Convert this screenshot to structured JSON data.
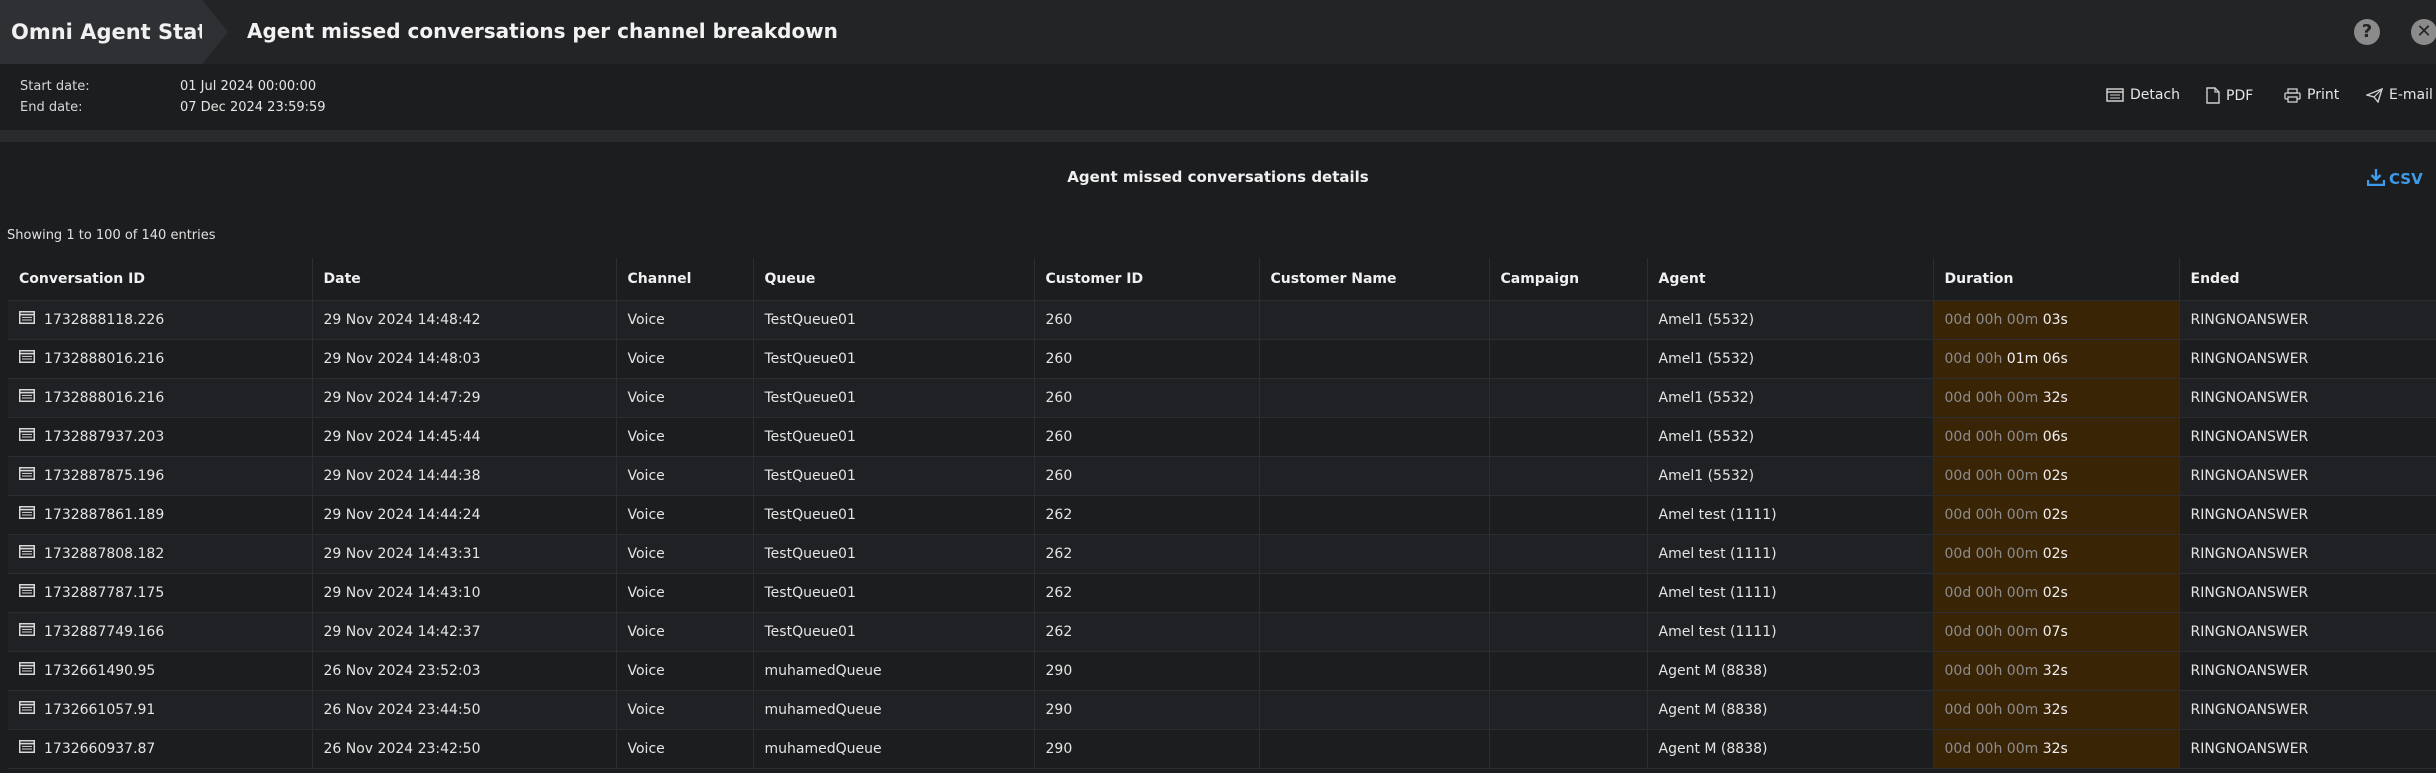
{
  "header": {
    "breadcrumb_root": "Omni Agent Stati...",
    "title": "Agent missed conversations per channel breakdown"
  },
  "dates": {
    "start_label": "Start date:",
    "start_value": "01 Jul 2024 00:00:00",
    "end_label": "End date:",
    "end_value": "07 Dec 2024 23:59:59"
  },
  "toolbar": {
    "detach": "Detach",
    "pdf": "PDF",
    "print": "Print",
    "email": "E-mail"
  },
  "section": {
    "title": "Agent missed conversations details",
    "csv": "CSV",
    "showing": "Showing 1 to 100 of 140 entries"
  },
  "table": {
    "columns": [
      "Conversation ID",
      "Date",
      "Channel",
      "Queue",
      "Customer ID",
      "Customer Name",
      "Campaign",
      "Agent",
      "Duration",
      "Ended"
    ],
    "rows": [
      {
        "id": "1732888118.226",
        "date": "29 Nov 2024 14:48:42",
        "channel": "Voice",
        "queue": "TestQueue01",
        "customer_id": "260",
        "customer_name": "",
        "campaign": "",
        "agent": "Amel1 (5532)",
        "dur_dim": "00d 00h 00m ",
        "dur_hl": "03s",
        "ended": "RINGNOANSWER"
      },
      {
        "id": "1732888016.216",
        "date": "29 Nov 2024 14:48:03",
        "channel": "Voice",
        "queue": "TestQueue01",
        "customer_id": "260",
        "customer_name": "",
        "campaign": "",
        "agent": "Amel1 (5532)",
        "dur_dim": "00d 00h ",
        "dur_hl": "01m 06s",
        "ended": "RINGNOANSWER"
      },
      {
        "id": "1732888016.216",
        "date": "29 Nov 2024 14:47:29",
        "channel": "Voice",
        "queue": "TestQueue01",
        "customer_id": "260",
        "customer_name": "",
        "campaign": "",
        "agent": "Amel1 (5532)",
        "dur_dim": "00d 00h 00m ",
        "dur_hl": "32s",
        "ended": "RINGNOANSWER"
      },
      {
        "id": "1732887937.203",
        "date": "29 Nov 2024 14:45:44",
        "channel": "Voice",
        "queue": "TestQueue01",
        "customer_id": "260",
        "customer_name": "",
        "campaign": "",
        "agent": "Amel1 (5532)",
        "dur_dim": "00d 00h 00m ",
        "dur_hl": "06s",
        "ended": "RINGNOANSWER"
      },
      {
        "id": "1732887875.196",
        "date": "29 Nov 2024 14:44:38",
        "channel": "Voice",
        "queue": "TestQueue01",
        "customer_id": "260",
        "customer_name": "",
        "campaign": "",
        "agent": "Amel1 (5532)",
        "dur_dim": "00d 00h 00m ",
        "dur_hl": "02s",
        "ended": "RINGNOANSWER"
      },
      {
        "id": "1732887861.189",
        "date": "29 Nov 2024 14:44:24",
        "channel": "Voice",
        "queue": "TestQueue01",
        "customer_id": "262",
        "customer_name": "",
        "campaign": "",
        "agent": "Amel test (1111)",
        "dur_dim": "00d 00h 00m ",
        "dur_hl": "02s",
        "ended": "RINGNOANSWER"
      },
      {
        "id": "1732887808.182",
        "date": "29 Nov 2024 14:43:31",
        "channel": "Voice",
        "queue": "TestQueue01",
        "customer_id": "262",
        "customer_name": "",
        "campaign": "",
        "agent": "Amel test (1111)",
        "dur_dim": "00d 00h 00m ",
        "dur_hl": "02s",
        "ended": "RINGNOANSWER"
      },
      {
        "id": "1732887787.175",
        "date": "29 Nov 2024 14:43:10",
        "channel": "Voice",
        "queue": "TestQueue01",
        "customer_id": "262",
        "customer_name": "",
        "campaign": "",
        "agent": "Amel test (1111)",
        "dur_dim": "00d 00h 00m ",
        "dur_hl": "02s",
        "ended": "RINGNOANSWER"
      },
      {
        "id": "1732887749.166",
        "date": "29 Nov 2024 14:42:37",
        "channel": "Voice",
        "queue": "TestQueue01",
        "customer_id": "262",
        "customer_name": "",
        "campaign": "",
        "agent": "Amel test (1111)",
        "dur_dim": "00d 00h 00m ",
        "dur_hl": "07s",
        "ended": "RINGNOANSWER"
      },
      {
        "id": "1732661490.95",
        "date": "26 Nov 2024 23:52:03",
        "channel": "Voice",
        "queue": "muhamedQueue",
        "customer_id": "290",
        "customer_name": "",
        "campaign": "",
        "agent": "Agent M (8838)",
        "dur_dim": "00d 00h 00m ",
        "dur_hl": "32s",
        "ended": "RINGNOANSWER"
      },
      {
        "id": "1732661057.91",
        "date": "26 Nov 2024 23:44:50",
        "channel": "Voice",
        "queue": "muhamedQueue",
        "customer_id": "290",
        "customer_name": "",
        "campaign": "",
        "agent": "Agent M (8838)",
        "dur_dim": "00d 00h 00m ",
        "dur_hl": "32s",
        "ended": "RINGNOANSWER"
      },
      {
        "id": "1732660937.87",
        "date": "26 Nov 2024 23:42:50",
        "channel": "Voice",
        "queue": "muhamedQueue",
        "customer_id": "290",
        "customer_name": "",
        "campaign": "",
        "agent": "Agent M (8838)",
        "dur_dim": "00d 00h 00m ",
        "dur_hl": "32s",
        "ended": "RINGNOANSWER"
      }
    ]
  },
  "colors": {
    "background": "#1c1d1f",
    "header_bar": "#232426",
    "duration_highlight": "#3a2406",
    "csv_accent": "#3d9be9"
  },
  "icons": {
    "help": "help-icon",
    "close": "close-icon",
    "detach": "detach-icon",
    "pdf": "pdf-icon",
    "print": "print-icon",
    "email": "email-icon",
    "csv": "download-icon",
    "row": "details-icon"
  }
}
